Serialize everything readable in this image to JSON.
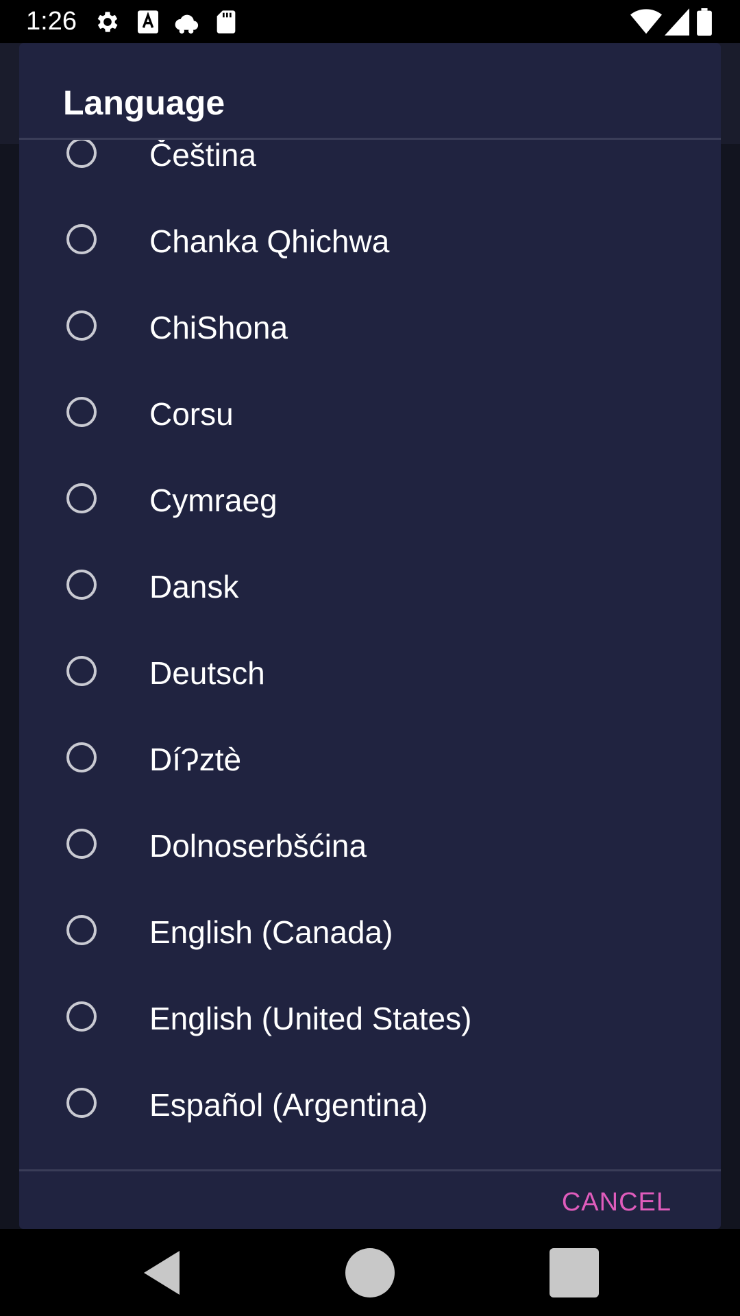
{
  "status_bar": {
    "time": "1:26",
    "icons": [
      "gear-icon",
      "font-icon",
      "cloud-icon",
      "sd-card-icon",
      "wifi-icon",
      "signal-icon",
      "battery-icon"
    ]
  },
  "dialog": {
    "title": "Language",
    "options": [
      "Čeština",
      "Chanka Qhichwa",
      "ChiShona",
      "Corsu",
      "Cymraeg",
      "Dansk",
      "Deutsch",
      "DíɁztè",
      "Dolnoserbšćina",
      "English (Canada)",
      "English (United States)",
      "Español (Argentina)"
    ],
    "cancel_label": "CANCEL"
  },
  "colors": {
    "dialog_bg": "#202340",
    "accent": "#e05cbc",
    "radio": "#c9cad2"
  },
  "nav_bar": {
    "icons": [
      "back-icon",
      "home-icon",
      "recents-icon"
    ]
  }
}
